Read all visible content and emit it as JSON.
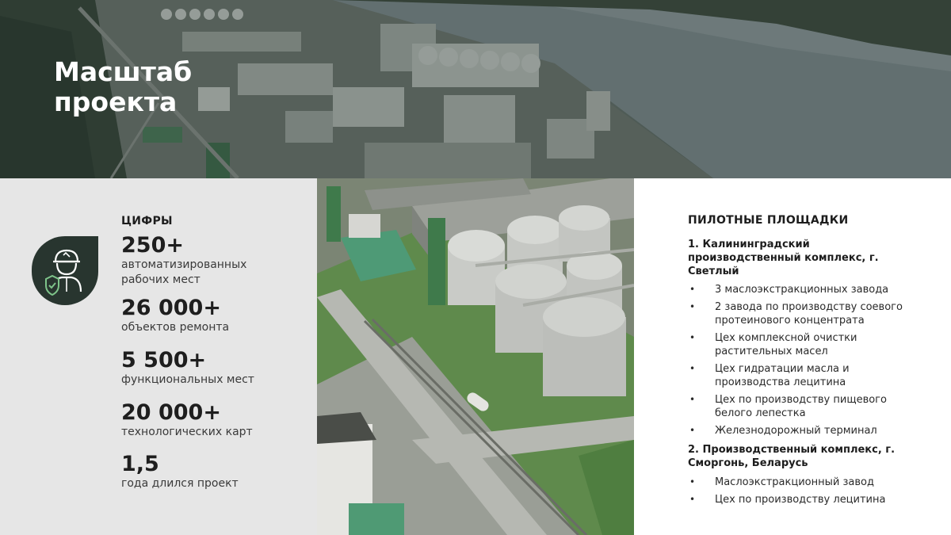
{
  "banner": {
    "title": "Масштаб проекта"
  },
  "stats": {
    "heading": "ЦИФРЫ",
    "badge_icon": "worker-helmet-shield-icon",
    "items": [
      {
        "value": "250+",
        "label": "автоматизированных рабочих мест"
      },
      {
        "value": "26 000+",
        "label": "объектов ремонта"
      },
      {
        "value": "5 500+",
        "label": "функциональных мест"
      },
      {
        "value": "20 000+",
        "label": "технологических карт"
      },
      {
        "value": "1,5",
        "label": "года длился проект"
      }
    ]
  },
  "photo": {
    "subject": "grain-silo-plant-aerial-photo"
  },
  "pilot": {
    "heading": "ПИЛОТНЫЕ ПЛОЩАДКИ",
    "sites": [
      {
        "title": "1. Калининградский производственный комплекс, г. Светлый",
        "items": [
          "3 маслоэкстракционных завода",
          "2 завода по производству соевого протеинового концентрата",
          "Цех комплексной очистки растительных масел",
          "Цех гидратации масла и производства лецитина",
          "Цех по производству пищевого белого лепестка",
          "Железнодорожный терминал"
        ]
      },
      {
        "title": "2. Производственный комплекс, г. Сморгонь, Беларусь",
        "items": [
          "Маслоэкстракционный завод",
          "Цех по производству лецитина"
        ]
      }
    ]
  },
  "colors": {
    "badge": "#28352f",
    "stats_bg": "#e6e6e6",
    "text": "#1d1d1d"
  }
}
